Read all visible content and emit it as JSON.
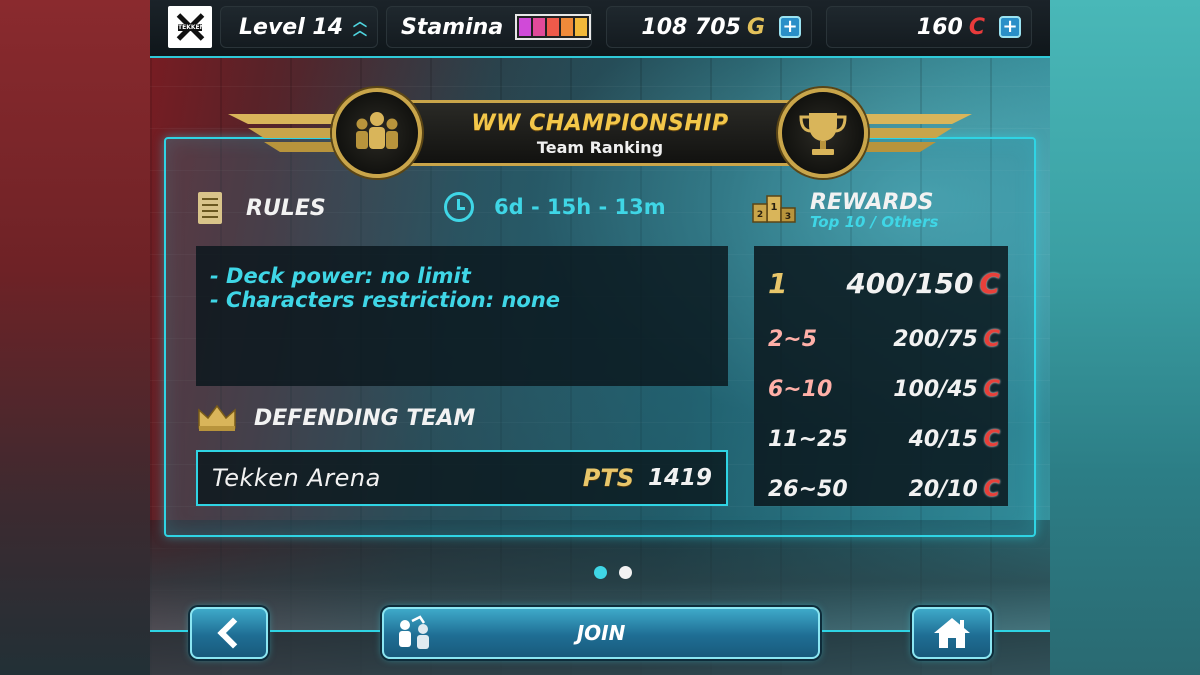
{
  "topbar": {
    "level_label": "Level 14",
    "stamina_label": "Stamina",
    "stamina_cells": [
      "#d04ad8",
      "#e24a9a",
      "#ee5a4a",
      "#f08a3a",
      "#f2b83a"
    ],
    "gold_amount": "108 705",
    "gold_unit": "G",
    "coin_amount": "160",
    "coin_unit": "C",
    "plus_symbol": "+"
  },
  "banner": {
    "title": "WW CHAMPIONSHIP",
    "subtitle": "Team Ranking"
  },
  "rules": {
    "heading": "RULES",
    "timer": "6d - 15h - 13m",
    "lines": [
      "- Deck power: no limit",
      "- Characters restriction: none"
    ]
  },
  "defending": {
    "heading": "DEFENDING TEAM",
    "team_name": "Tekken Arena",
    "pts_label": "PTS",
    "pts_value": "1419"
  },
  "rewards": {
    "heading": "REWARDS",
    "subheading": "Top 10 / Others",
    "currency": "C",
    "rows": [
      {
        "rank": "1",
        "reward": "400/150"
      },
      {
        "rank": "2~5",
        "reward": "200/75"
      },
      {
        "rank": "6~10",
        "reward": "100/45"
      },
      {
        "rank": "11~25",
        "reward": "40/15"
      },
      {
        "rank": "26~50",
        "reward": "20/10"
      }
    ]
  },
  "pager": {
    "current_page": 1,
    "total_pages": 2
  },
  "bottom": {
    "join_label": "JOIN"
  },
  "colors": {
    "accent_cyan": "#2fd4e4",
    "gold": "#c9a54a",
    "currency_red": "#e8403a"
  }
}
